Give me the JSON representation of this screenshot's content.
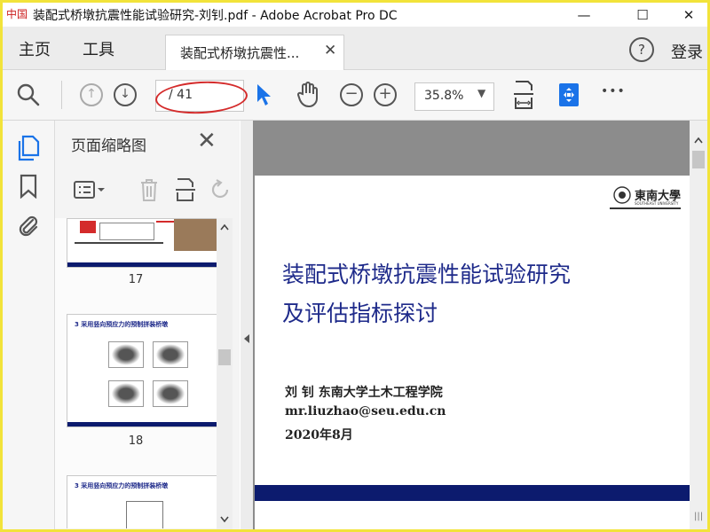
{
  "window": {
    "title": "装配式桥墩抗震性能试验研究-刘钊.pdf - Adobe Acrobat Pro DC",
    "watermark": "中国",
    "minimize_glyph": "—",
    "maximize_glyph": "☐",
    "close_glyph": "✕"
  },
  "menubar": {
    "home": "主页",
    "tools": "工具",
    "tab_label": "装配式桥墩抗震性...",
    "tab_close": "✕",
    "help": "?",
    "login": "登录"
  },
  "toolbar": {
    "page_current": "",
    "page_total": "/ 41",
    "zoom_value": "35.8%",
    "zoom_caret": "▼",
    "more": "•••"
  },
  "sidebar": {
    "pane_title": "页面缩略图",
    "pane_close": "✕"
  },
  "thumbnails": [
    {
      "number": "17",
      "caption": ""
    },
    {
      "number": "18",
      "caption": "3 采用竖向预应力的预制拼装桥墩"
    },
    {
      "number": "",
      "caption": "3 采用竖向预应力的预制拼装桥墩"
    }
  ],
  "document": {
    "logo_text": "東南大學",
    "logo_sub": "SOUTHEAST UNIVERSITY",
    "title_line1": "装配式桥墩抗震性能试验研究",
    "title_line2": "及评估指标探讨",
    "author_line": "刘 钊  东南大学土木工程学院",
    "email": "mr.liuzhao@seu.edu.cn",
    "date": "2020年8月"
  },
  "colors": {
    "slide_title": "#1e2a8a",
    "slide_band": "#0c1b6e",
    "annotation": "#d42b2b",
    "frame": "#f2e33a",
    "accent_blue": "#1a73e8"
  },
  "icons": [
    "search-icon",
    "scroll-up-icon",
    "scroll-down-icon",
    "select-cursor-icon",
    "hand-icon",
    "zoom-out-icon",
    "zoom-in-icon",
    "fit-page-icon",
    "scroll-mode-icon",
    "thumbnails-icon",
    "bookmarks-icon",
    "attachments-icon",
    "options-icon",
    "delete-icon",
    "extract-icon",
    "undo-icon"
  ]
}
